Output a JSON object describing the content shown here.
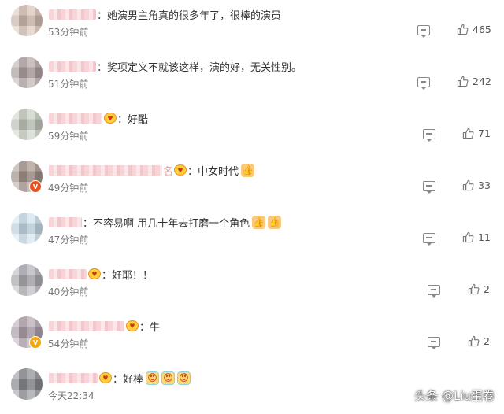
{
  "comments": [
    {
      "sep": "：",
      "text": "她演男主角真的很多年了，很棒的演员",
      "time": "53分钟前",
      "likes": "465"
    },
    {
      "sep": "：",
      "text": "奖项定义不就该这样，演的好，无关性别。",
      "time": "51分钟前",
      "likes": "242"
    },
    {
      "sep": "：",
      "text": "好酷",
      "time": "59分钟前",
      "likes": "71"
    },
    {
      "name_tail": "名",
      "sep": "：",
      "text": "中女时代",
      "time": "49分钟前",
      "likes": "33"
    },
    {
      "sep": "：",
      "text": "不容易啊 用几十年去打磨一个角色",
      "time": "47分钟前",
      "likes": "11"
    },
    {
      "sep": "：",
      "text": "好耶！！",
      "time": "40分钟前",
      "likes": "2"
    },
    {
      "sep": "：",
      "text": "牛",
      "time": "54分钟前",
      "likes": "2"
    },
    {
      "sep": "：",
      "text": "好棒",
      "time": "今天22:34",
      "likes": ""
    }
  ],
  "icons": {
    "reply": "reply-icon",
    "like": "thumbs-up-icon",
    "emoji_thumb": "thumbs-up-emoji",
    "emoji_face": "heart-eyes-emoji",
    "badge": "fan-badge-icon"
  },
  "watermark": "头条 @Liu蛋卷"
}
